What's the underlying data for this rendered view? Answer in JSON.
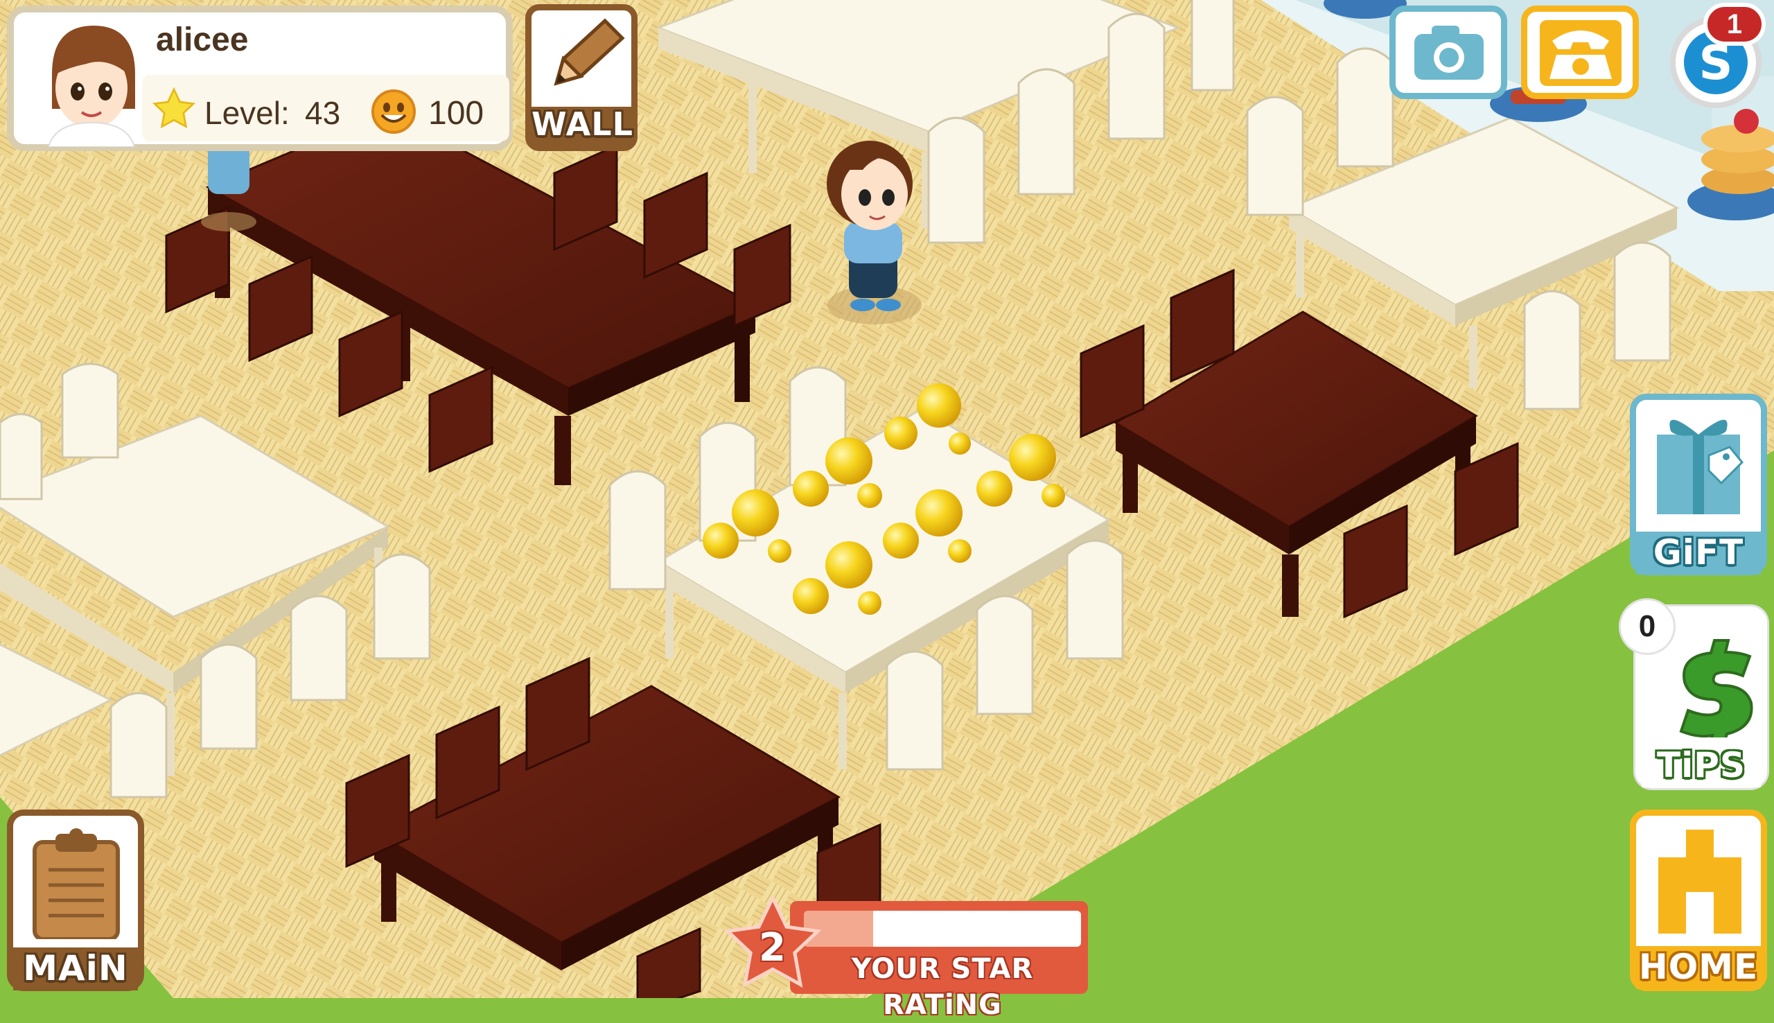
{
  "player": {
    "name": "alicee",
    "level_label": "Level:",
    "level": "43",
    "coins": "100"
  },
  "buttons": {
    "wall": "WALL",
    "gift": "GiFT",
    "tips": "TiPS",
    "tips_count": "0",
    "home": "HOME",
    "main": "MAiN"
  },
  "notifications": {
    "count": "1"
  },
  "star_rating": {
    "value": "2",
    "label": "YOUR STAR RATiNG",
    "progress": 0.25
  },
  "icons": [
    "avatar-chef",
    "star-icon",
    "smile-coin-icon",
    "pencil-icon",
    "camera-icon",
    "phone-icon",
    "s-coin-icon",
    "gift-icon",
    "dollar-icon",
    "house-icon",
    "clipboard-icon"
  ],
  "colors": {
    "grass": "#86c23f",
    "floor": "#f1dc94",
    "dark_wood": "#5e1c0f",
    "white_furniture": "#fbf7e8",
    "hud_brown": "#8a5a2b",
    "teal": "#6db8cc",
    "orange": "#f7b51c",
    "rating_red": "#e15a3e"
  }
}
